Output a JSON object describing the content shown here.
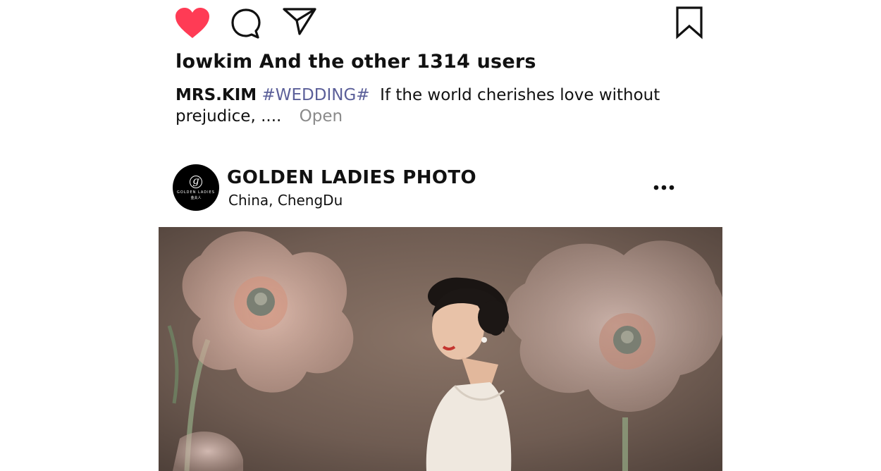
{
  "post_actions": {
    "like_color": "#ff3b55",
    "icons": [
      "heart-icon",
      "comment-icon",
      "share-icon",
      "bookmark-icon"
    ]
  },
  "likes": {
    "text": "lowkim And the other 1314 users"
  },
  "caption": {
    "user": "MRS.KIM",
    "hashtag": "#WEDDING#",
    "text": "If the world cherishes love without prejudice, ....",
    "open_label": "Open"
  },
  "next_post": {
    "avatar": {
      "brand": "GOLDEN LADIES",
      "brand_sub": "金夫人"
    },
    "account_name": "GOLDEN LADIES PHOTO",
    "location_country": "China,",
    "location_city": "ChengDu",
    "more_icon": "more-horizontal-icon",
    "photo_alt": "wedding portrait"
  }
}
